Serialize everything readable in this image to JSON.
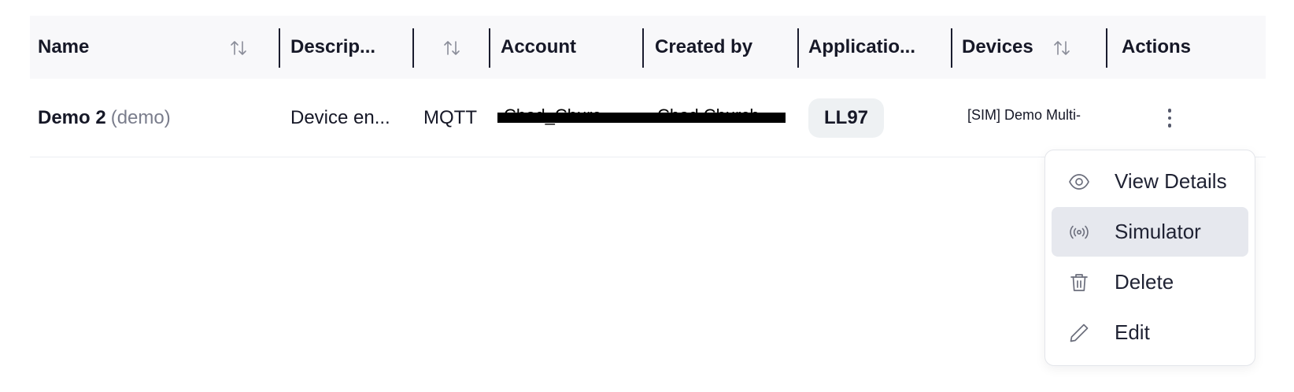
{
  "table": {
    "headers": {
      "name": "Name",
      "description": "Descrip...",
      "account": "Account",
      "created_by": "Created by",
      "application": "Applicatio...",
      "devices": "Devices",
      "actions": "Actions"
    },
    "row": {
      "name": "Demo 2",
      "name_sub": "(demo)",
      "description": "Device en...",
      "protocol": "MQTT",
      "account": "Chad_Churc...",
      "created_by": "Chad Church",
      "application": "LL97",
      "devices": "[SIM] Demo Multi-"
    }
  },
  "menu": {
    "items": [
      {
        "label": "View Details",
        "icon": "eye-icon"
      },
      {
        "label": "Simulator",
        "icon": "broadcast-icon"
      },
      {
        "label": "Delete",
        "icon": "trash-icon"
      },
      {
        "label": "Edit",
        "icon": "pencil-icon"
      }
    ],
    "active_index": 1
  },
  "colors": {
    "header_bg": "#f8f8fa",
    "badge_bg": "#eef1f3",
    "menu_active_bg": "#e6e8ee",
    "muted_text": "#7a7d8c"
  }
}
